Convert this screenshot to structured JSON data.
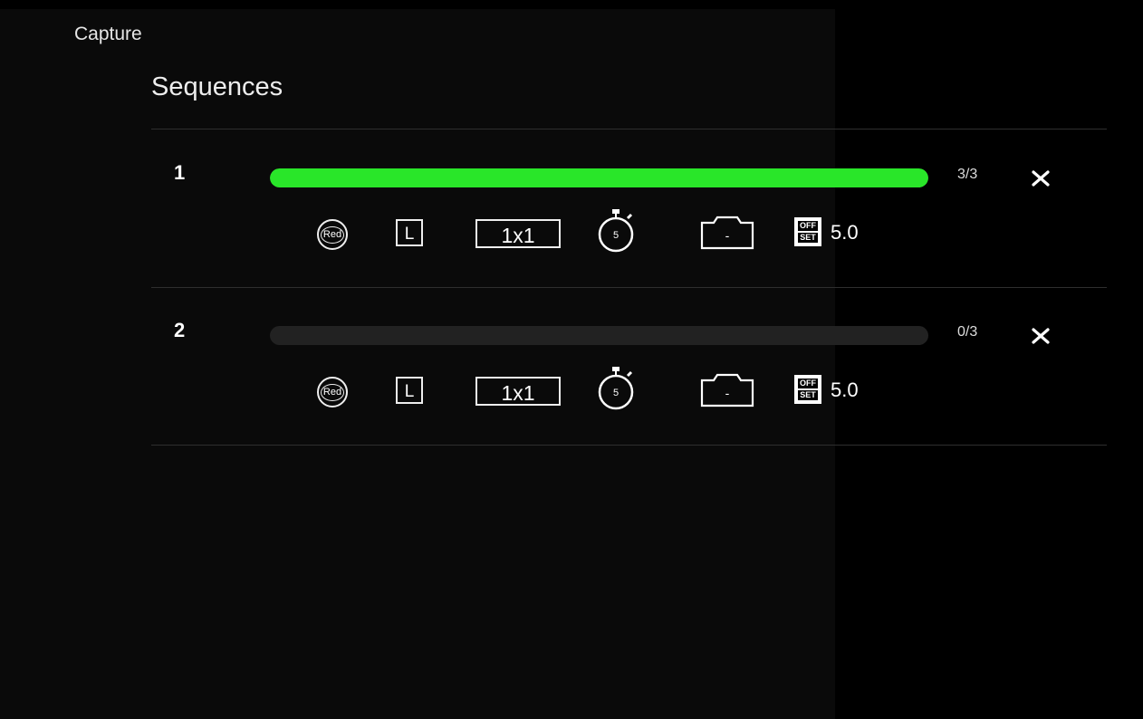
{
  "app": {
    "title": "Capture"
  },
  "section": {
    "title": "Sequences"
  },
  "colors": {
    "progress_fill": "#29e629",
    "track": "#222222"
  },
  "sequences": [
    {
      "number": "1",
      "progress_fraction": 1.0,
      "count": "3/3",
      "filter_label": "Red",
      "frame_type": "L",
      "binning": "1x1",
      "exposure": "5",
      "camera_value": "-",
      "offset_label_top": "OFF",
      "offset_label_bottom": "SET",
      "offset_value": "5.0"
    },
    {
      "number": "2",
      "progress_fraction": 0.0,
      "count": "0/3",
      "filter_label": "Red",
      "frame_type": "L",
      "binning": "1x1",
      "exposure": "5",
      "camera_value": "-",
      "offset_label_top": "OFF",
      "offset_label_bottom": "SET",
      "offset_value": "5.0"
    }
  ]
}
